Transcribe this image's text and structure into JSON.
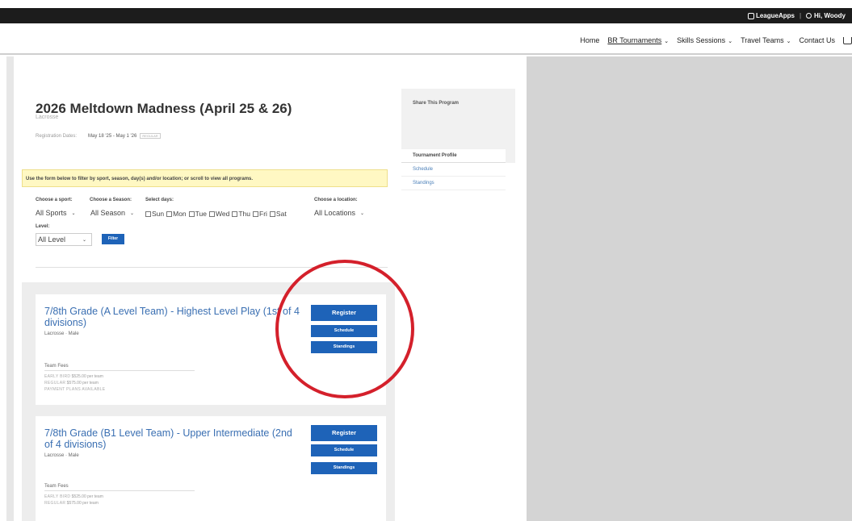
{
  "topbar": {
    "brand": "LeagueApps",
    "separator": "|",
    "greeting": "Hi, Woody"
  },
  "nav": {
    "items": [
      {
        "label": "Home",
        "dropdown": false
      },
      {
        "label": "BR Tournaments",
        "dropdown": true,
        "active": true
      },
      {
        "label": "Skills Sessions",
        "dropdown": true
      },
      {
        "label": "Travel Teams",
        "dropdown": true
      },
      {
        "label": "Contact Us",
        "dropdown": false
      }
    ],
    "cart_icon": "cart-icon"
  },
  "program": {
    "title": "2026 Meltdown Madness (April 25 & 26)",
    "sport": "Lacrosse",
    "reg_label": "Registration Dates:",
    "reg_value": "May 18 '25 - May 1 '26",
    "reg_badge": "REGULAR"
  },
  "sidebar": {
    "share_label": "Share This Program",
    "menu": [
      "Tournament Profile",
      "Schedule",
      "Standings"
    ]
  },
  "filter": {
    "notice": "Use the form below to filter by sport, season, day(s) and/or location; or scroll to view all programs.",
    "sport_label": "Choose a sport:",
    "sport_value": "All Sports",
    "season_label": "Choose a Season:",
    "season_value": "All Season",
    "days_label": "Select days:",
    "days": [
      "Sun",
      "Mon",
      "Tue",
      "Wed",
      "Thu",
      "Fri",
      "Sat"
    ],
    "location_label": "Choose a location:",
    "location_value": "All Locations",
    "level_label": "Level:",
    "level_value": "All Level",
    "filter_button": "Filter"
  },
  "cards": [
    {
      "title": "7/8th Grade (A Level Team) - Highest Level Play (1st of 4 divisions)",
      "meta": "Lacrosse · Male",
      "fees_heading": "Team Fees",
      "fee_lines": [
        {
          "label": "EARLY BIRD",
          "value": "$525.00 per team"
        },
        {
          "label": "REGULAR",
          "value": "$575.00 per team"
        },
        {
          "label": "PAYMENT PLANS AVAILABLE",
          "value": ""
        }
      ],
      "register": "Register",
      "schedule": "Schedule",
      "standings": "Standings"
    },
    {
      "title": "7/8th Grade (B1 Level Team) - Upper Intermediate (2nd of 4 divisions)",
      "meta": "Lacrosse · Male",
      "fees_heading": "Team Fees",
      "fee_lines": [
        {
          "label": "EARLY BIRD",
          "value": "$525.00 per team"
        },
        {
          "label": "REGULAR",
          "value": "$575.00 per team"
        }
      ],
      "register": "Register",
      "schedule": "Schedule",
      "standings": "Standings"
    }
  ],
  "colors": {
    "accent": "#1e63b8",
    "link": "#3a6fb2",
    "annotation": "#d4202b"
  }
}
